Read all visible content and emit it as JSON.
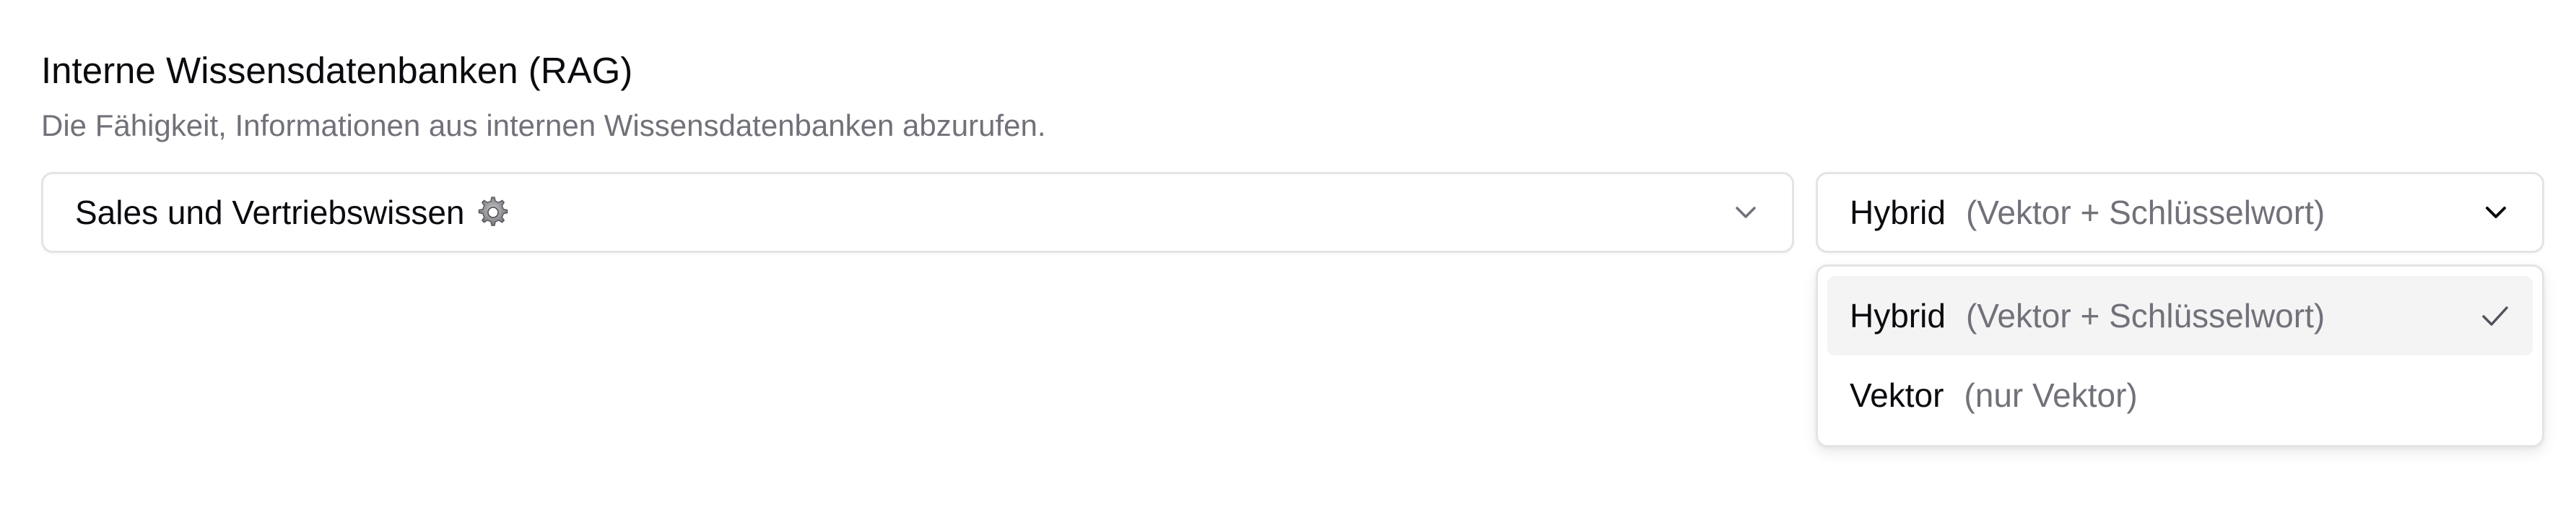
{
  "section": {
    "title": "Interne Wissensdatenbanken (RAG)",
    "description": "Die Fähigkeit, Informationen aus internen Wissensdatenbanken abzurufen."
  },
  "knowledge_base_select": {
    "value": "Sales und Vertriebswissen",
    "icon": "gear-icon"
  },
  "search_mode_select": {
    "value_label": "Hybrid",
    "value_detail": "(Vektor + Schlüsselwort)",
    "expanded": true,
    "options": [
      {
        "label": "Hybrid",
        "detail": "(Vektor + Schlüsselwort)",
        "selected": true
      },
      {
        "label": "Vektor",
        "detail": "(nur Vektor)",
        "selected": false
      }
    ]
  },
  "colors": {
    "text_primary": "#0b0b0f",
    "text_muted": "#71717a",
    "border": "#e4e4e7",
    "option_highlight": "#f4f4f5"
  }
}
